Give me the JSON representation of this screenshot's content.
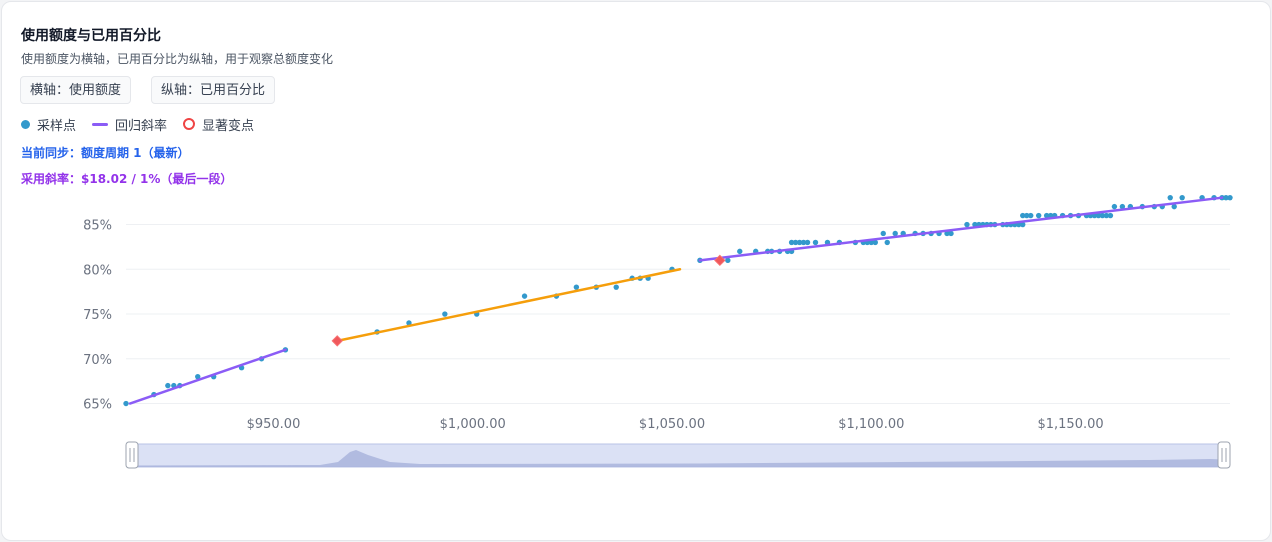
{
  "header": {
    "title": "使用额度与已用百分比",
    "subtitle": "使用额度为横轴，已用百分比为纵轴，用于观察总额度变化"
  },
  "controls": {
    "x_axis_button": "横轴：使用额度",
    "y_axis_button": "纵轴：已用百分比"
  },
  "legend": {
    "samples": "采样点",
    "regression": "回归斜率",
    "changepoint": "显著变点"
  },
  "info": {
    "sync": "当前同步：额度周期 1（最新）",
    "slope": "采用斜率：$18.02 / 1%（最后一段）"
  },
  "colors": {
    "sample": "#3399cc",
    "regression": "#8b5cf6",
    "regression_middle": "#f59e0b",
    "changepoint": "#ef4444"
  },
  "chart_data": {
    "type": "scatter",
    "title": "",
    "xlabel": "",
    "ylabel": "",
    "xlim": [
      913,
      1190
    ],
    "ylim": [
      64.5,
      88.3
    ],
    "x_ticks": [
      950,
      1000,
      1050,
      1100,
      1150
    ],
    "x_tick_labels": [
      "$950.00",
      "$1,000.00",
      "$1,050.00",
      "$1,100.00",
      "$1,150.00"
    ],
    "y_ticks": [
      65,
      70,
      75,
      80,
      85
    ],
    "y_tick_labels": [
      "65%",
      "70%",
      "75%",
      "80%",
      "85%"
    ],
    "series": [
      {
        "kind": "samples",
        "points": [
          [
            913,
            65
          ],
          [
            920,
            66
          ],
          [
            923.5,
            67
          ],
          [
            925,
            67
          ],
          [
            926.5,
            67
          ],
          [
            931,
            68
          ],
          [
            935,
            68
          ],
          [
            942,
            69
          ],
          [
            947,
            70
          ],
          [
            953,
            71
          ],
          [
            976,
            73
          ],
          [
            984,
            74
          ],
          [
            993,
            75
          ],
          [
            1001,
            75
          ],
          [
            1013,
            77
          ],
          [
            1021,
            77
          ],
          [
            1026,
            78
          ],
          [
            1031,
            78
          ],
          [
            1036,
            78
          ],
          [
            1040,
            79
          ],
          [
            1042,
            79
          ],
          [
            1044,
            79
          ],
          [
            1050,
            80
          ],
          [
            1057,
            81
          ],
          [
            1064,
            81
          ],
          [
            1067,
            82
          ],
          [
            1071,
            82
          ],
          [
            1074,
            82
          ],
          [
            1075,
            82
          ],
          [
            1077,
            82
          ],
          [
            1079,
            82
          ],
          [
            1080,
            82
          ],
          [
            1080,
            83
          ],
          [
            1081,
            83
          ],
          [
            1082,
            83
          ],
          [
            1083,
            83
          ],
          [
            1084,
            83
          ],
          [
            1086,
            83
          ],
          [
            1089,
            83
          ],
          [
            1092,
            83
          ],
          [
            1096,
            83
          ],
          [
            1098,
            83
          ],
          [
            1099,
            83
          ],
          [
            1100,
            83
          ],
          [
            1101,
            83
          ],
          [
            1104,
            83
          ],
          [
            1103,
            84
          ],
          [
            1106,
            84
          ],
          [
            1108,
            84
          ],
          [
            1111,
            84
          ],
          [
            1113,
            84
          ],
          [
            1115,
            84
          ],
          [
            1117,
            84
          ],
          [
            1119,
            84
          ],
          [
            1120,
            84
          ],
          [
            1124,
            85
          ],
          [
            1126,
            85
          ],
          [
            1127,
            85
          ],
          [
            1128,
            85
          ],
          [
            1129,
            85
          ],
          [
            1130,
            85
          ],
          [
            1131,
            85
          ],
          [
            1133,
            85
          ],
          [
            1134,
            85
          ],
          [
            1135,
            85
          ],
          [
            1136,
            85
          ],
          [
            1137,
            85
          ],
          [
            1138,
            85
          ],
          [
            1138,
            86
          ],
          [
            1139,
            86
          ],
          [
            1140,
            86
          ],
          [
            1142,
            86
          ],
          [
            1144,
            86
          ],
          [
            1145,
            86
          ],
          [
            1146,
            86
          ],
          [
            1148,
            86
          ],
          [
            1150,
            86
          ],
          [
            1152,
            86
          ],
          [
            1154,
            86
          ],
          [
            1155,
            86
          ],
          [
            1156,
            86
          ],
          [
            1157,
            86
          ],
          [
            1158,
            86
          ],
          [
            1159,
            86
          ],
          [
            1160,
            86
          ],
          [
            1161,
            87
          ],
          [
            1163,
            87
          ],
          [
            1165,
            87
          ],
          [
            1168,
            87
          ],
          [
            1171,
            87
          ],
          [
            1173,
            87
          ],
          [
            1176,
            87
          ],
          [
            1175,
            88
          ],
          [
            1178,
            88
          ],
          [
            1183,
            88
          ],
          [
            1186,
            88
          ],
          [
            1188,
            88
          ],
          [
            1189,
            88
          ],
          [
            1190,
            88
          ]
        ]
      },
      {
        "kind": "regression",
        "segment": 1,
        "from": [
          914,
          65
        ],
        "to": [
          953,
          71
        ]
      },
      {
        "kind": "regression",
        "segment": 2,
        "from": [
          966,
          72
        ],
        "to": [
          1052,
          80
        ]
      },
      {
        "kind": "regression",
        "segment": 3,
        "from": [
          1057,
          81
        ],
        "to": [
          1188,
          88
        ]
      }
    ],
    "changepoints": [
      [
        966,
        72
      ],
      [
        1062,
        81
      ]
    ],
    "legend_position": "top-left",
    "grid": true,
    "zoom_slider": {
      "start": 0,
      "end": 1
    }
  }
}
